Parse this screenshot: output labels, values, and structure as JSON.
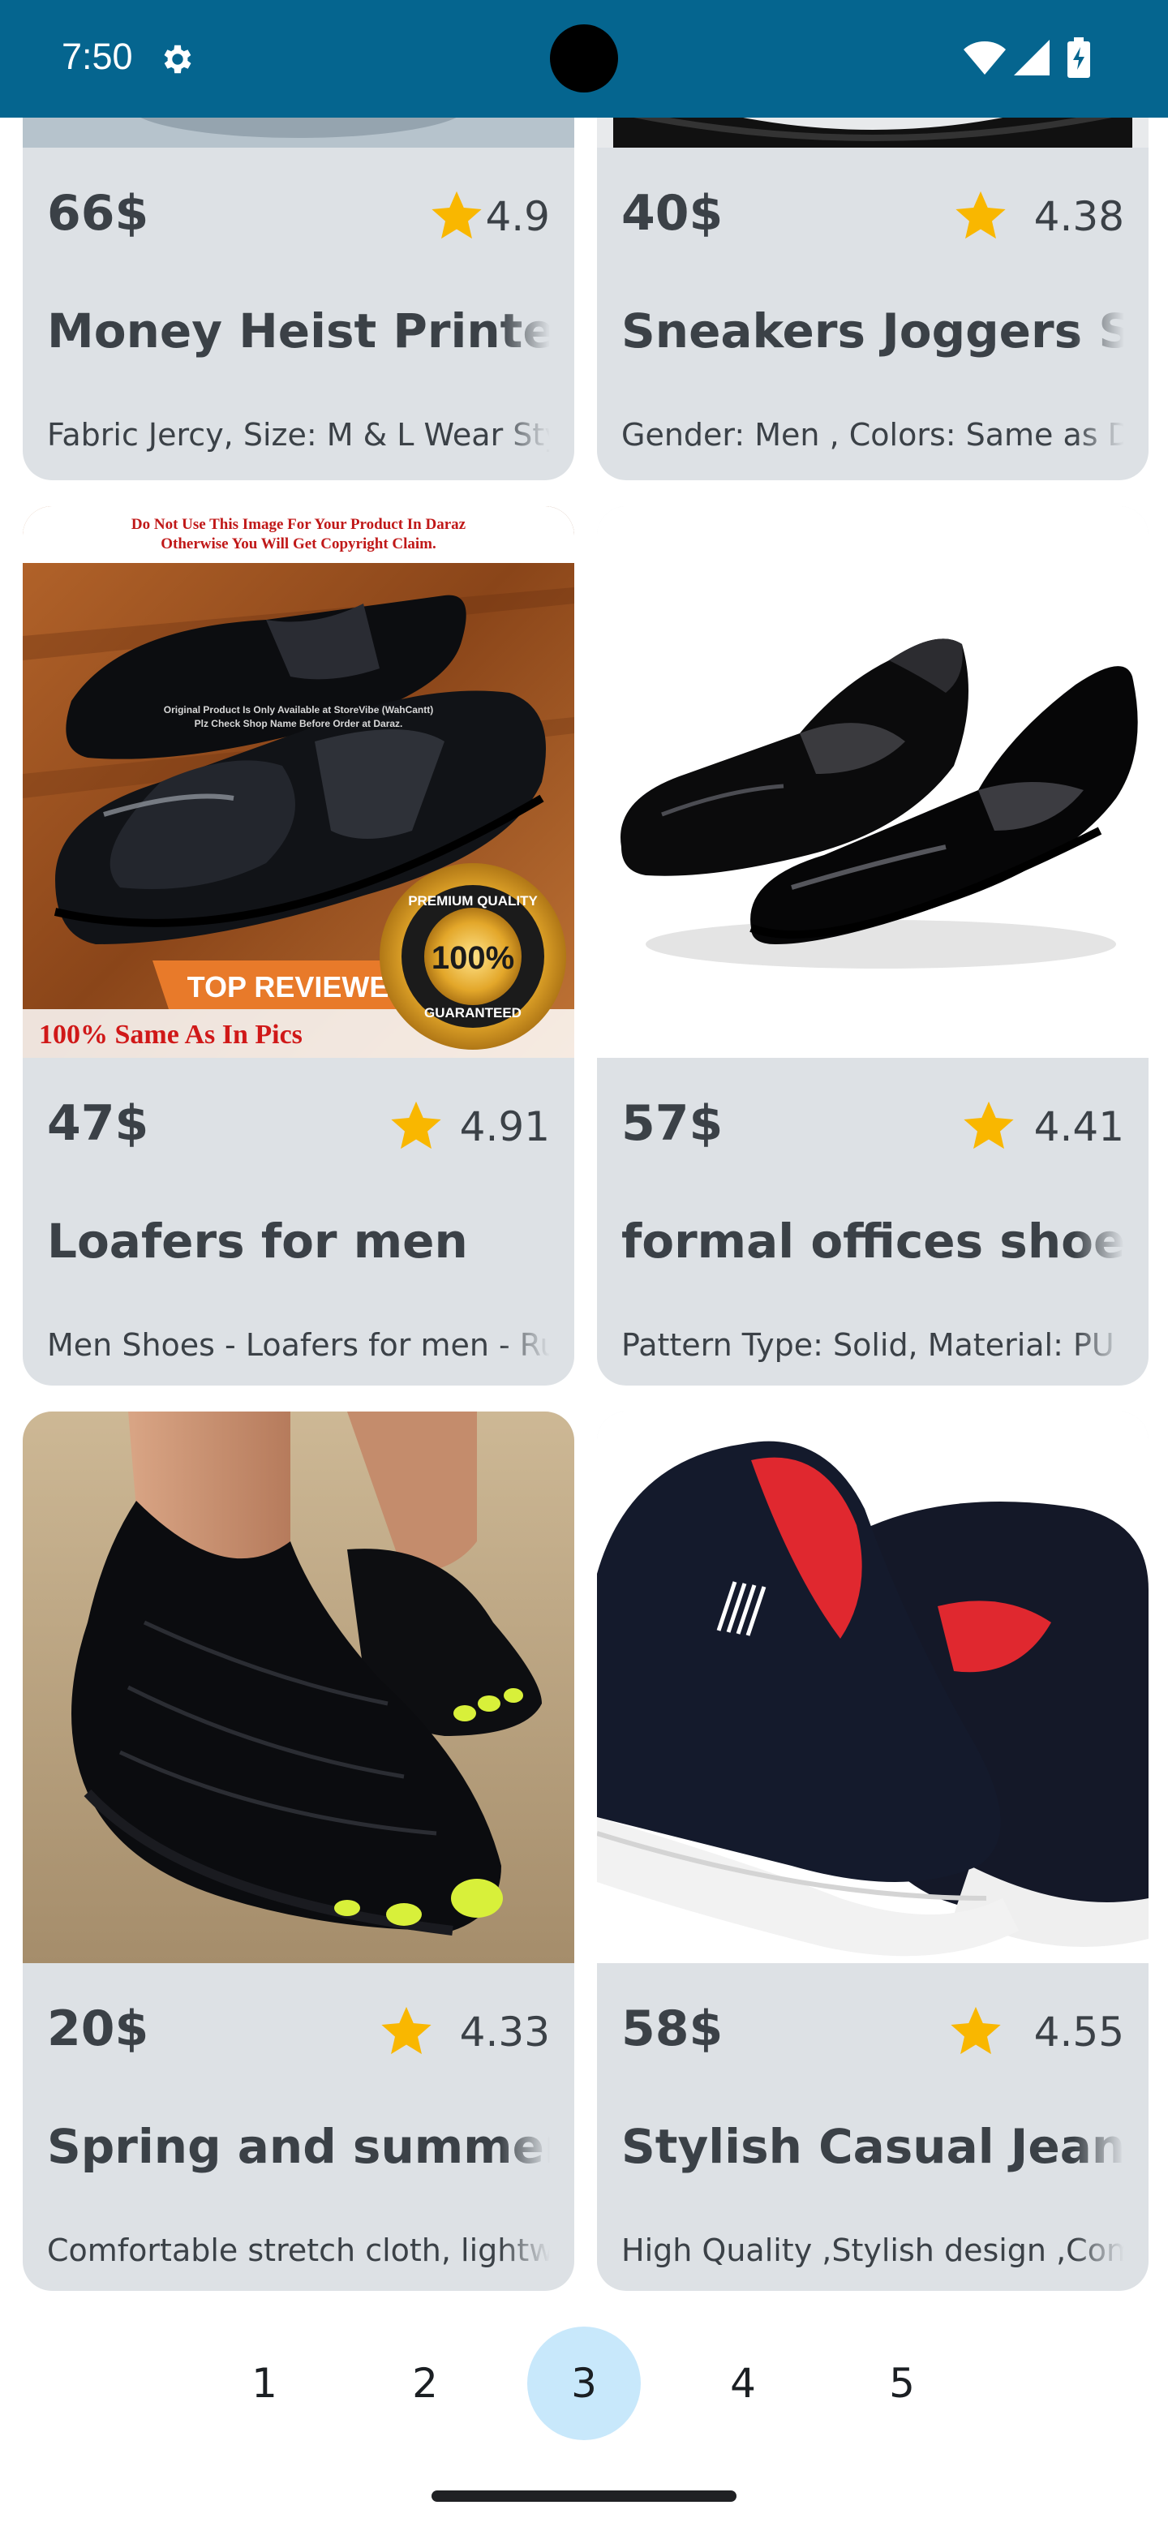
{
  "status_bar": {
    "time": "7:50"
  },
  "products": [
    {
      "price": "66$",
      "rating": "4.9",
      "title": "Money Heist Printed Shirt",
      "description": "Fabric Jercy, Size: M & L Wear Stylish"
    },
    {
      "price": "40$",
      "rating": "4.38",
      "title": "Sneakers Joggers Shoes",
      "description": "Gender: Men , Colors: Same as Display"
    },
    {
      "price": "47$",
      "rating": "4.91",
      "title": "Loafers for men",
      "description": "Men Shoes - Loafers for men - Rubber"
    },
    {
      "price": "57$",
      "rating": "4.41",
      "title": "formal offices shoes",
      "description": "Pattern Type: Solid, Material: PU"
    },
    {
      "price": "20$",
      "rating": "4.33",
      "title": "Spring and summershoes",
      "description": "Comfortable stretch cloth, lightweight"
    },
    {
      "price": "58$",
      "rating": "4.55",
      "title": "Stylish Casual Jeans Shoes",
      "description": "High Quality ,Stylish design ,Comfortable"
    }
  ],
  "loafer_image_text": {
    "top_line_1": "Do Not Use This Image For Your Product In Daraz",
    "top_line_2": "Otherwise You Will Get Copyright Claim.",
    "mid_line_1": "Original Product Is Only Available at StoreVibe (WahCantt)",
    "mid_line_2": "Plz Check Shop Name Before Order at Daraz.",
    "banner": "TOP REVIEWED",
    "bottom": "100% Same As In Pics",
    "seal_percent": "100%",
    "seal_top": "PREMIUM QUALITY",
    "seal_bottom": "GUARANTEED"
  },
  "pagination": {
    "pages": [
      "1",
      "2",
      "3",
      "4",
      "5"
    ],
    "current": "3"
  },
  "colors": {
    "status_bar": "#05658f",
    "card_bg": "#dde1e5",
    "star": "#f9b700",
    "active_page": "#c8e8fb"
  }
}
